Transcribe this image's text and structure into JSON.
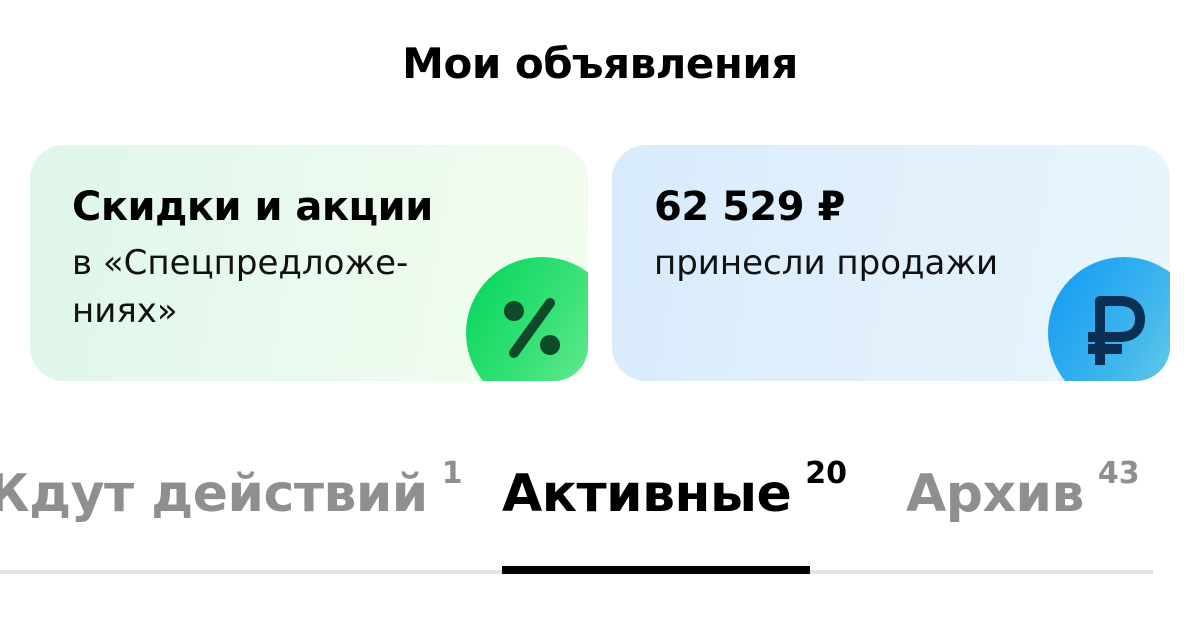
{
  "header": {
    "title": "Мои объявления"
  },
  "cards": {
    "promo": {
      "title": "Скидки и акции",
      "subtitle": "в «Спецпредложе-\nниях»",
      "icon": "percent-icon",
      "accent": "#00d55a"
    },
    "sales": {
      "title": "62 529 ₽",
      "subtitle": "принесли продажи",
      "icon": "ruble-icon",
      "accent": "#1199f5"
    }
  },
  "tabs": [
    {
      "label": "Ждут действий",
      "count": "1",
      "active": false
    },
    {
      "label": "Активные",
      "count": "20",
      "active": true
    },
    {
      "label": "Архив",
      "count": "43",
      "active": false
    }
  ]
}
